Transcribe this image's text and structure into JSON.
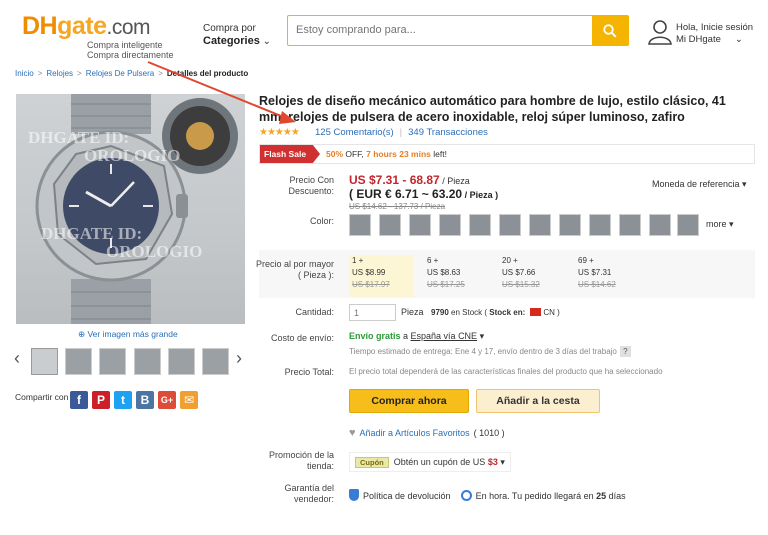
{
  "header": {
    "logo": {
      "dh": "DH",
      "gate": "gate",
      "com": ".com"
    },
    "tagline_1": "Compra inteligente",
    "tagline_2": "Compra directamente",
    "categories_top": "Compra por",
    "categories_label": "Categories",
    "search_placeholder": "Estoy comprando para...",
    "greeting": "Hola, Inicie sesión",
    "account": "Mi DHgate"
  },
  "breadcrumb": {
    "items": [
      "Inicio",
      "Relojes",
      "Relojes De Pulsera"
    ],
    "current": "Detalles del producto"
  },
  "gallery": {
    "watermark_1": "DHGATE ID:",
    "watermark_2": "OROLOGIO",
    "watermark_3": "DHGATE ID:",
    "watermark_4": "OROLOGIO",
    "zoom_label": "Ver imagen más grande",
    "prev": "‹",
    "next": "›",
    "share_label": "Compartir con"
  },
  "product": {
    "title": "Relojes de diseño mecánico automático para hombre de lujo, estilo clásico, 41 mm, relojes de pulsera de acero inoxidable, reloj súper luminoso, zafiro",
    "stars": "★★★★★",
    "reviews": "125 Comentario(s)",
    "transactions": "349 Transacciones",
    "flash_sale": "Flash Sale",
    "flash_pct": "50%",
    "flash_off": " OFF, ",
    "flash_time": "7 hours 23 mins",
    "flash_left": " left!",
    "price_label": "Precio Con Descuento:",
    "price_usd": "US $7.31 - 68.87",
    "price_unit": " / Pieza",
    "price_eur": "( EUR € 6.71 ~ 63.20",
    "price_eur_unit": " / Pieza )",
    "price_old": "US $14.62 - 137.73 / Pieza",
    "currency_ref": "Moneda de referencia ▾",
    "color_label": "Color:",
    "more_label": "more ▾",
    "wholesale_label": "Precio al por mayor",
    "wholesale_sub": "( Pieza ):",
    "tiers": [
      {
        "qty": "1 +",
        "price": "US $8.99",
        "old": "US $17.97"
      },
      {
        "qty": "6 +",
        "price": "US $8.63",
        "old": "US $17.25"
      },
      {
        "qty": "20 +",
        "price": "US $7.66",
        "old": "US $15.32"
      },
      {
        "qty": "69 +",
        "price": "US $7.31",
        "old": "US $14.62"
      }
    ],
    "qty_label": "Cantidad:",
    "qty_value": "1",
    "qty_unit": "Pieza",
    "stock_count": "9790",
    "stock_text": " en Stock ( ",
    "stock_en": "Stock en:",
    "stock_cn": "CN )",
    "shipping_label": "Costo de envío:",
    "shipping_free": "Envío gratis",
    "shipping_to": " a ",
    "shipping_dest": "España vía CNE",
    "shipping_est": "Tiempo estimado de entrega: Ene 4 y 17, envío dentro de 3 días del trabajo",
    "total_label": "Precio Total:",
    "total_text": "El precio total dependerá de las características finales del producto que ha seleccionado",
    "buy_now": "Comprar ahora",
    "add_cart": "Añadir a la cesta",
    "fav_label": "Añadir a Artículos Favoritos",
    "fav_count": "( 1010 )",
    "promo_label": "Promoción de la tienda:",
    "coupon_tag": "Cupón",
    "coupon_text": "Obtén un cupón de US ",
    "coupon_value": "$3",
    "guarantee_label": "Garantía del vendedor:",
    "return_policy": "Política de devolución",
    "on_time": "En hora. Tu pedido llegará en ",
    "on_time_days": "25",
    "on_time_suffix": " días"
  },
  "colors": {
    "accent": "#f4b400",
    "price_red": "#c0262c",
    "link": "#2a6fb8",
    "annotation_arrow": "#e0472f"
  }
}
